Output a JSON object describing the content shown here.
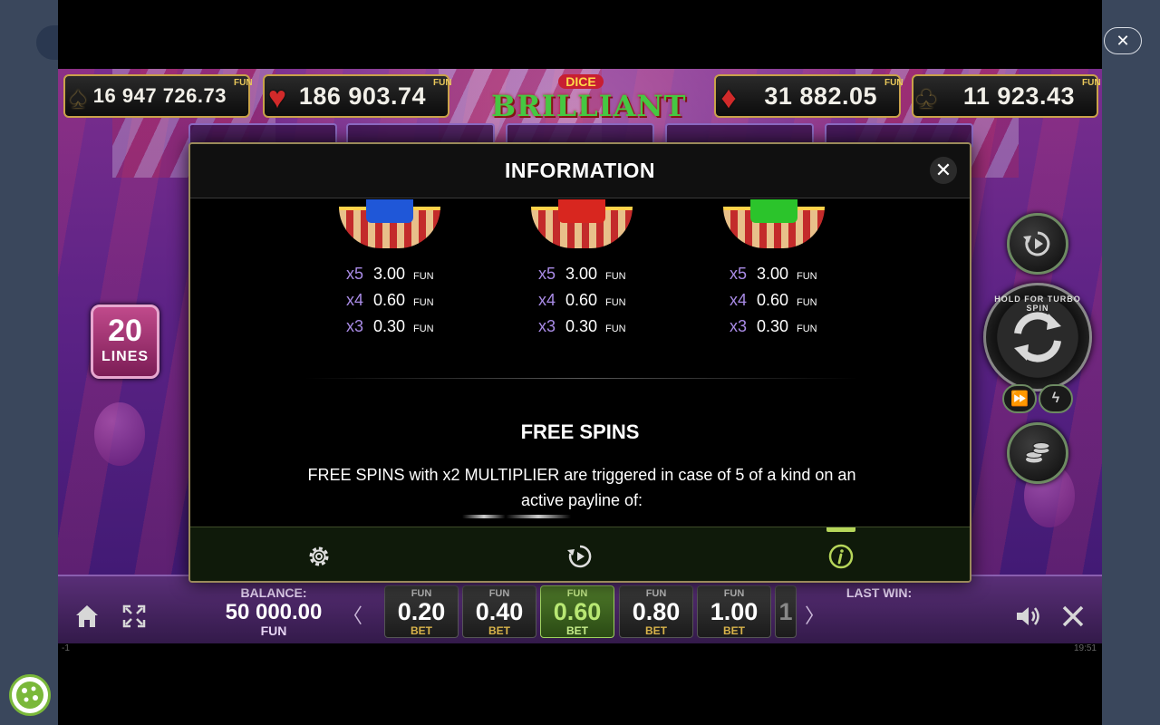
{
  "host": {
    "close_icon": "close-icon",
    "cookie_icon": "cookie-icon"
  },
  "jackpots": [
    {
      "suit": "♠",
      "suit_color": "#1c1c1c",
      "amount": "16 947 726.73",
      "currency": "FUN"
    },
    {
      "suit": "♥",
      "suit_color": "#d12a2a",
      "amount": "186 903.74",
      "currency": "FUN"
    },
    {
      "suit": "♦",
      "suit_color": "#d12a2a",
      "amount": "31 882.05",
      "currency": "FUN"
    },
    {
      "suit": "♣",
      "suit_color": "#1c1c1c",
      "amount": "11 923.43",
      "currency": "FUN"
    }
  ],
  "logo": {
    "small": "DICE",
    "big": "BRILLIANT"
  },
  "lines": {
    "count": "20",
    "label": "LINES"
  },
  "controls": {
    "turbo_hint": "HOLD FOR TURBO SPIN"
  },
  "info_modal": {
    "title": "INFORMATION",
    "symbols": [
      {
        "die_color": "#1f57d8",
        "pays": [
          {
            "mult": "x5",
            "value": "3.00",
            "currency": "FUN"
          },
          {
            "mult": "x4",
            "value": "0.60",
            "currency": "FUN"
          },
          {
            "mult": "x3",
            "value": "0.30",
            "currency": "FUN"
          }
        ]
      },
      {
        "die_color": "#d8261f",
        "pays": [
          {
            "mult": "x5",
            "value": "3.00",
            "currency": "FUN"
          },
          {
            "mult": "x4",
            "value": "0.60",
            "currency": "FUN"
          },
          {
            "mult": "x3",
            "value": "0.30",
            "currency": "FUN"
          }
        ]
      },
      {
        "die_color": "#2bc42b",
        "pays": [
          {
            "mult": "x5",
            "value": "3.00",
            "currency": "FUN"
          },
          {
            "mult": "x4",
            "value": "0.60",
            "currency": "FUN"
          },
          {
            "mult": "x3",
            "value": "0.30",
            "currency": "FUN"
          }
        ]
      }
    ],
    "free_spins_title": "FREE SPINS",
    "free_spins_text": "FREE SPINS with x2 MULTIPLIER are triggered in case of 5 of a kind on an active payline of:",
    "tabs": [
      {
        "name": "settings",
        "icon": "gear-icon"
      },
      {
        "name": "autoplay",
        "icon": "replay-icon"
      },
      {
        "name": "info",
        "icon": "info-icon",
        "active": true
      }
    ],
    "accent_color": "#b6d65a"
  },
  "bottom_bar": {
    "balance_label": "BALANCE:",
    "balance_value": "50 000.00",
    "balance_currency": "FUN",
    "bets": [
      {
        "currency": "FUN",
        "value": "0.20",
        "label": "BET"
      },
      {
        "currency": "FUN",
        "value": "0.40",
        "label": "BET"
      },
      {
        "currency": "FUN",
        "value": "0.60",
        "label": "BET",
        "active": true
      },
      {
        "currency": "FUN",
        "value": "0.80",
        "label": "BET"
      },
      {
        "currency": "FUN",
        "value": "1.00",
        "label": "BET"
      }
    ],
    "partial_bet": "1",
    "last_win_label": "LAST WIN:",
    "status_left": "-1",
    "clock": "19:51"
  }
}
